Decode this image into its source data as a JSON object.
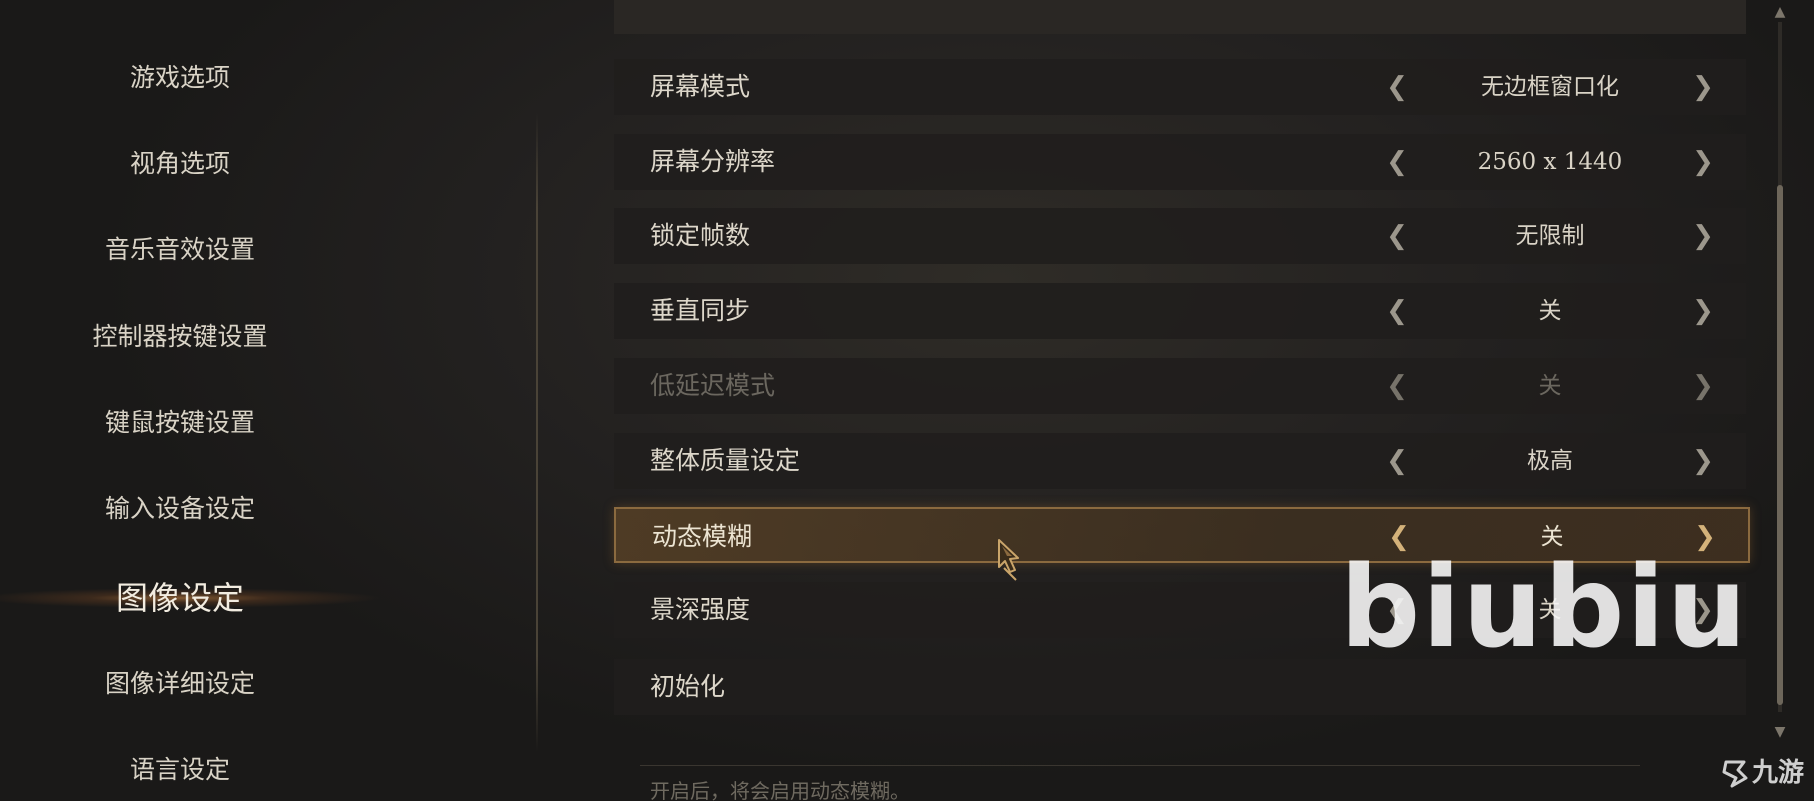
{
  "sidebar": {
    "items": [
      {
        "label": "游戏选项"
      },
      {
        "label": "视角选项"
      },
      {
        "label": "音乐音效设置"
      },
      {
        "label": "控制器按键设置"
      },
      {
        "label": "键鼠按键设置"
      },
      {
        "label": "输入设备设定"
      },
      {
        "label": "图像设定",
        "active": true
      },
      {
        "label": "图像详细设定"
      },
      {
        "label": "语言设定"
      }
    ]
  },
  "settings": {
    "rows": [
      {
        "label": "屏幕模式",
        "value": "无边框窗口化"
      },
      {
        "label": "屏幕分辨率",
        "value": "2560 x 1440"
      },
      {
        "label": "锁定帧数",
        "value": "无限制"
      },
      {
        "label": "垂直同步",
        "value": "关"
      },
      {
        "label": "低延迟模式",
        "value": "关",
        "disabled": true
      },
      {
        "label": "整体质量设定",
        "value": "极高"
      },
      {
        "label": "动态模糊",
        "value": "关",
        "selected": true
      },
      {
        "label": "景深强度",
        "value": "关"
      },
      {
        "label": "初始化",
        "value": ""
      }
    ],
    "left_arrow": "❮",
    "right_arrow": "❯"
  },
  "description": "开启后，将会启用动态模糊。",
  "scrollbar": {
    "up": "▲",
    "down": "▼"
  },
  "watermarks": {
    "biubiu": "biubiu",
    "jiuyou": "九游"
  },
  "icons": {
    "cursor": "ornate-cursor-icon",
    "logo": "jiuyou-logo-icon"
  },
  "colors": {
    "accent_border": "#8b6a3f",
    "active_glow": "#d68c46",
    "text": "#d9d3c6",
    "disabled_text": "#6b675f"
  }
}
